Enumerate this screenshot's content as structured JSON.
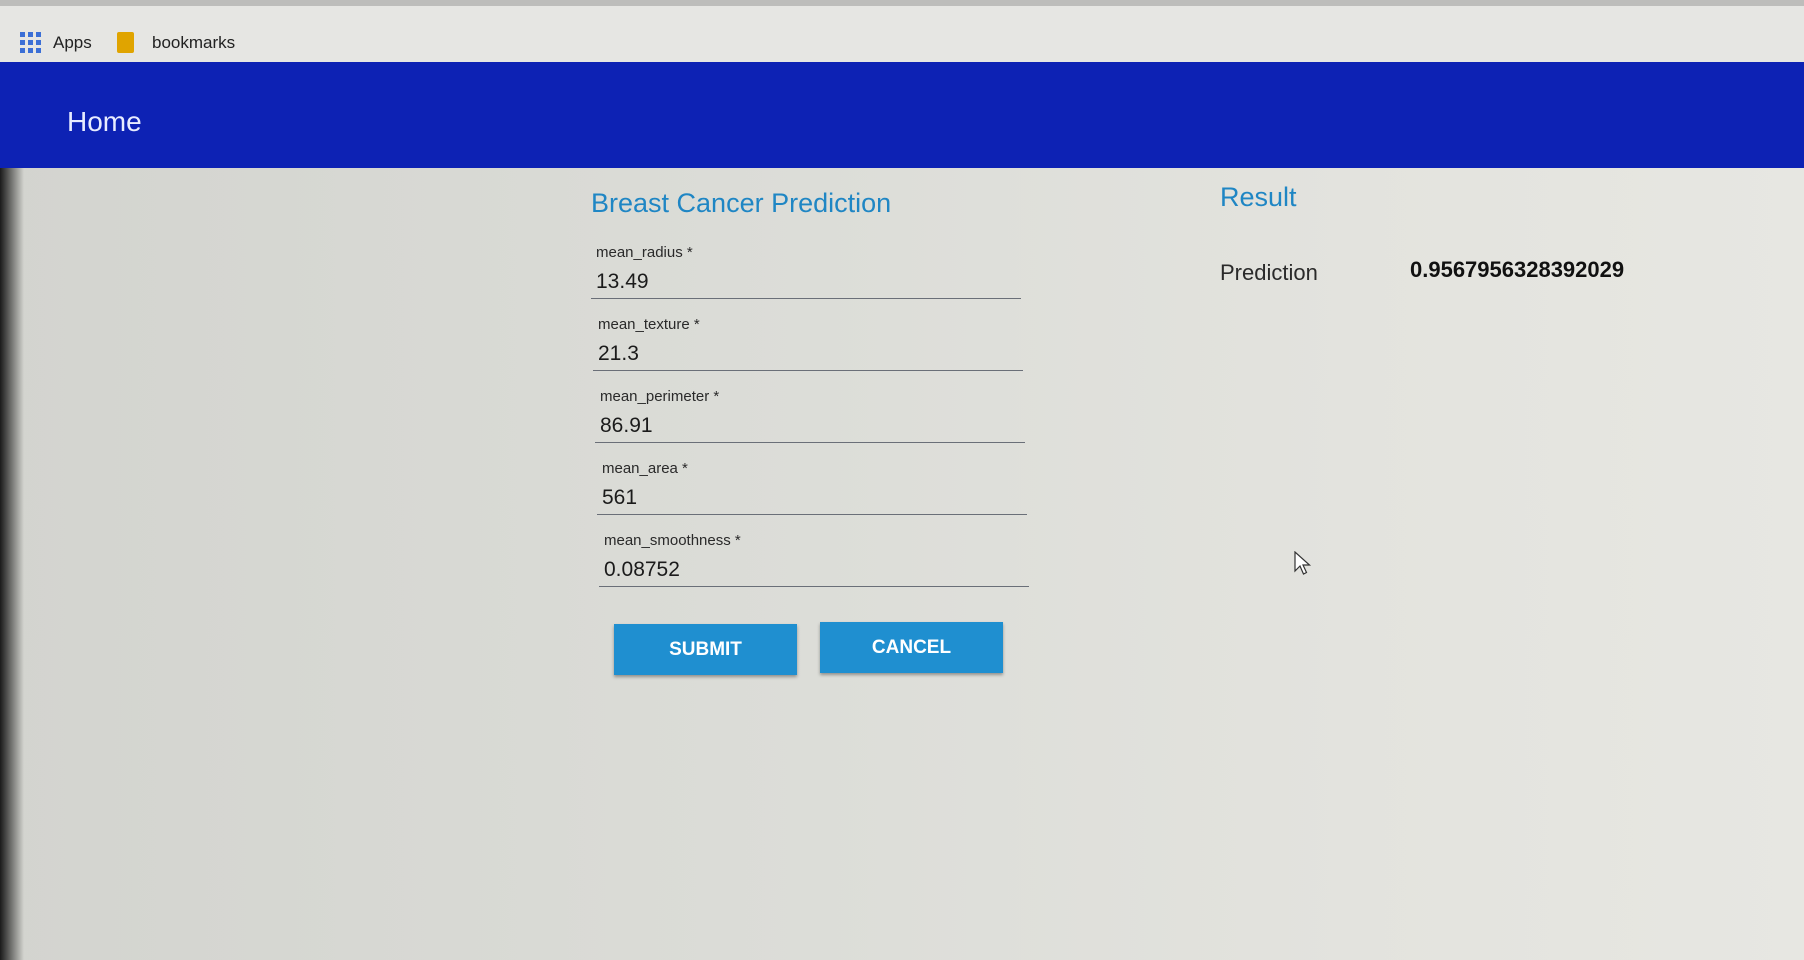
{
  "bookmarks_bar": {
    "apps_label": "Apps",
    "bookmarks_label": "bookmarks"
  },
  "navbar": {
    "home_label": "Home",
    "color": "#0d22b4"
  },
  "form": {
    "title": "Breast Cancer Prediction",
    "fields": [
      {
        "label": "mean_radius *",
        "value": "13.49"
      },
      {
        "label": "mean_texture *",
        "value": "21.3"
      },
      {
        "label": "mean_perimeter *",
        "value": "86.91"
      },
      {
        "label": "mean_area *",
        "value": "561"
      },
      {
        "label": "mean_smoothness *",
        "value": "0.08752"
      }
    ],
    "submit_label": "SUBMIT",
    "cancel_label": "CANCEL",
    "accent_color": "#1f8fd0"
  },
  "result": {
    "title": "Result",
    "prediction_label": "Prediction",
    "prediction_value": "0.9567956328392029"
  }
}
